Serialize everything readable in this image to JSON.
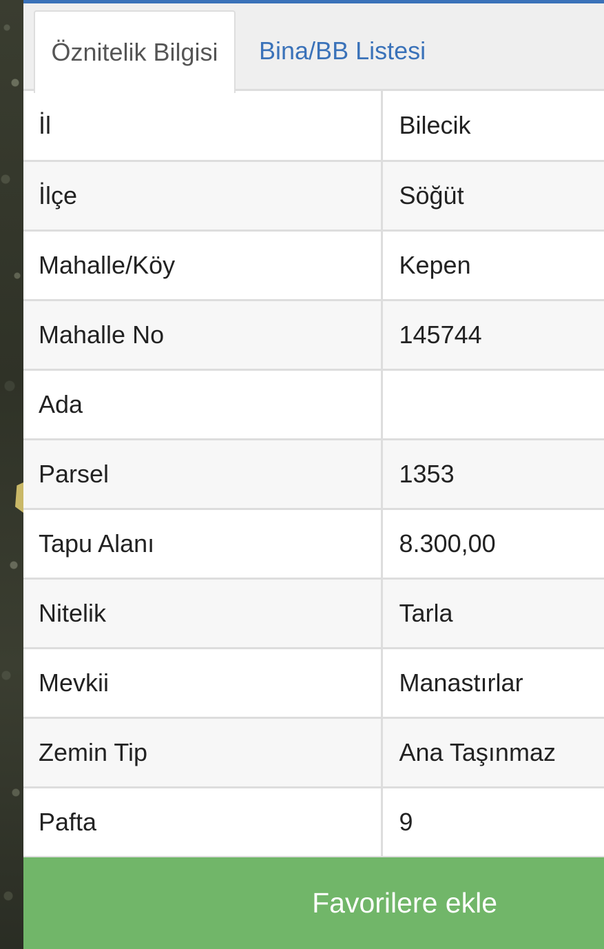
{
  "tabs": [
    {
      "label": "Öznitelik Bilgisi",
      "active": true
    },
    {
      "label": "Bina/BB Listesi",
      "active": false
    }
  ],
  "attributes": [
    {
      "key": "İl",
      "value": "Bilecik"
    },
    {
      "key": "İlçe",
      "value": "Söğüt"
    },
    {
      "key": "Mahalle/Köy",
      "value": "Kepen"
    },
    {
      "key": "Mahalle No",
      "value": "145744"
    },
    {
      "key": "Ada",
      "value": ""
    },
    {
      "key": "Parsel",
      "value": "1353"
    },
    {
      "key": "Tapu Alanı",
      "value": "8.300,00"
    },
    {
      "key": "Nitelik",
      "value": "Tarla"
    },
    {
      "key": "Mevkii",
      "value": "Manastırlar"
    },
    {
      "key": "Zemin Tip",
      "value": "Ana Taşınmaz"
    },
    {
      "key": "Pafta",
      "value": "9"
    }
  ],
  "favorite_button": {
    "label": "Favorilere ekle"
  },
  "colors": {
    "accent_blue": "#3a72b9",
    "button_green": "#71b669",
    "border_gray": "#dddddd"
  }
}
